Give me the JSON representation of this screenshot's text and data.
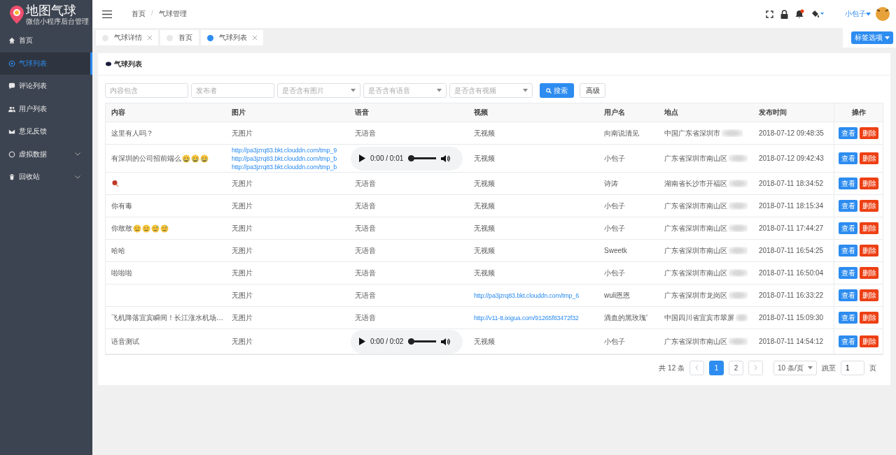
{
  "logo": {
    "title": "地图气球",
    "subtitle": "微信小程序后台管理"
  },
  "sidebar": {
    "items": [
      {
        "label": "首页",
        "selected": false,
        "expandable": false
      },
      {
        "label": "气球列表",
        "selected": true,
        "expandable": false
      },
      {
        "label": "评论列表",
        "selected": false,
        "expandable": false
      },
      {
        "label": "用户列表",
        "selected": false,
        "expandable": false
      },
      {
        "label": "意见反馈",
        "selected": false,
        "expandable": false
      },
      {
        "label": "虚拟数据",
        "selected": false,
        "expandable": true
      },
      {
        "label": "回收站",
        "selected": false,
        "expandable": true
      }
    ]
  },
  "breadcrumb": [
    {
      "label": "首页"
    },
    {
      "separator": "/",
      "label": "气球管理"
    }
  ],
  "header": {
    "user": "小包子",
    "has_notification": true
  },
  "tabs": [
    {
      "label": "气球详情",
      "selected": false,
      "closable": true
    },
    {
      "label": "首页",
      "selected": false,
      "closable": false
    },
    {
      "label": "气球列表",
      "selected": true,
      "closable": true
    }
  ],
  "tab_options": "标签选项",
  "card_title": "气球列表",
  "filters": [
    {
      "kind": "input",
      "placeholder": "内容包含"
    },
    {
      "kind": "input",
      "placeholder": "发布者"
    },
    {
      "kind": "select",
      "placeholder": "是否含有图片"
    },
    {
      "kind": "select",
      "placeholder": "是否含有语音"
    },
    {
      "kind": "select",
      "placeholder": "是否含有视频"
    }
  ],
  "search_button": "搜索",
  "advanced_button": "高级",
  "table": {
    "columns": [
      "内容",
      "图片",
      "语音",
      "视频",
      "用户名",
      "地点",
      "发布时间",
      "操作"
    ],
    "rows": [
      {
        "content": "这里有人吗？",
        "images": [
          {
            "kind": "text",
            "text": "无图片"
          }
        ],
        "audio": {
          "kind": "text",
          "text": "无语音"
        },
        "video": {
          "kind": "text",
          "text": "无视频"
        },
        "user": "向南说清见",
        "place": "中国广东省深圳市",
        "time": "2018-07-12 09:48:35",
        "view": "查看",
        "delete": "删除"
      },
      {
        "content": "有深圳的公司招前端么",
        "emojis": [
          {
            "kind": "crying"
          },
          {
            "kind": "crying"
          },
          {
            "kind": "crying"
          }
        ],
        "images": [
          {
            "kind": "link",
            "text": "http://pa3jzrq83.bkt.clouddn.com/tmp_9"
          },
          {
            "kind": "link",
            "text": "http://pa3jzrq83.bkt.clouddn.com/tmp_b"
          },
          {
            "kind": "link",
            "text": "http://pa3jzrq83.bkt.clouddn.com/tmp_b"
          }
        ],
        "audio": {
          "kind": "player",
          "text": "0:00 / 0:01",
          "level": 0
        },
        "video": {
          "kind": "text",
          "text": "无视频"
        },
        "user": "小包子",
        "place": "广东省深圳市南山区",
        "time": "2018-07-12 09:42:43",
        "view": "查看",
        "delete": "删除"
      },
      {
        "emojis": [
          {
            "kind": "drumstick"
          }
        ],
        "images": [
          {
            "kind": "text",
            "text": "无图片"
          }
        ],
        "audio": {
          "kind": "text",
          "text": "无语音"
        },
        "video": {
          "kind": "text",
          "text": "无视频"
        },
        "user": "诗涛",
        "place": "湖南省长沙市开福区",
        "time": "2018-07-11 18:34:52",
        "view": "查看",
        "delete": "删除"
      },
      {
        "content": "你有毒",
        "images": [
          {
            "kind": "text",
            "text": "无图片"
          }
        ],
        "audio": {
          "kind": "text",
          "text": "无语音"
        },
        "video": {
          "kind": "text",
          "text": "无视频"
        },
        "user": "小包子",
        "place": "广东省深圳市南山区",
        "time": "2018-07-11 18:15:34",
        "view": "查看",
        "delete": "删除"
      },
      {
        "content": "你敢敢",
        "emojis": [
          {
            "kind": "meh"
          },
          {
            "kind": "meh"
          },
          {
            "kind": "sweat"
          },
          {
            "kind": "sweat"
          }
        ],
        "images": [
          {
            "kind": "text",
            "text": "无图片"
          }
        ],
        "audio": {
          "kind": "text",
          "text": "无语音"
        },
        "video": {
          "kind": "text",
          "text": "无视频"
        },
        "user": "小包子",
        "place": "广东省深圳市南山区",
        "time": "2018-07-11 17:44:27",
        "view": "查看",
        "delete": "删除"
      },
      {
        "content": "哈哈",
        "images": [
          {
            "kind": "text",
            "text": "无图片"
          }
        ],
        "audio": {
          "kind": "text",
          "text": "无语音"
        },
        "video": {
          "kind": "text",
          "text": "无视频"
        },
        "user": "Sweetk",
        "place": "广东省深圳市南山区",
        "time": "2018-07-11 16:54:25",
        "view": "查看",
        "delete": "删除"
      },
      {
        "content": "啦啦啦",
        "images": [
          {
            "kind": "text",
            "text": "无图片"
          }
        ],
        "audio": {
          "kind": "text",
          "text": "无语音"
        },
        "video": {
          "kind": "text",
          "text": "无视频"
        },
        "user": "小包子",
        "place": "广东省深圳市南山区",
        "time": "2018-07-11 16:50:04",
        "view": "查看",
        "delete": "删除"
      },
      {
        "images": [
          {
            "kind": "text",
            "text": "无图片"
          }
        ],
        "audio": {
          "kind": "text",
          "text": "无语音"
        },
        "video": {
          "kind": "link",
          "text": "http://pa3jzrq83.bkt.clouddn.com/tmp_6"
        },
        "user": "wuli恩恩",
        "place": "广东省深圳市龙岗区",
        "time": "2018-07-11 16:33:22",
        "view": "查看",
        "delete": "删除"
      },
      {
        "content": "飞机降落宜宾瞬间！长江涨水机场…",
        "images": [
          {
            "kind": "text",
            "text": "无图片"
          }
        ],
        "audio": {
          "kind": "text",
          "text": "无语音"
        },
        "video": {
          "kind": "link",
          "text": "http://v11-tt.ixigua.com/91265f83472f32"
        },
        "user": "滴血的黑玫瑰'",
        "place": "中国四川省宜宾市翠屏",
        "time": "2018-07-11 15:09:30",
        "view": "查看",
        "delete": "删除"
      },
      {
        "content": "语音测试",
        "images": [
          {
            "kind": "text",
            "text": "无图片"
          }
        ],
        "audio": {
          "kind": "player",
          "text": "0:00 / 0:02",
          "level": 0
        },
        "video": {
          "kind": "text",
          "text": "无视频"
        },
        "user": "小包子",
        "place": "广东省深圳市南山区",
        "time": "2018-07-11 14:54:12",
        "view": "查看",
        "delete": "删除"
      }
    ]
  },
  "pagination": {
    "total": "共 12 条",
    "pages": [
      {
        "label": "1",
        "selected": true
      },
      {
        "label": "2",
        "selected": false
      }
    ],
    "page_size": "10 条/页",
    "jump_label": "跳至",
    "jump_value": "1",
    "page_suffix": "页"
  }
}
